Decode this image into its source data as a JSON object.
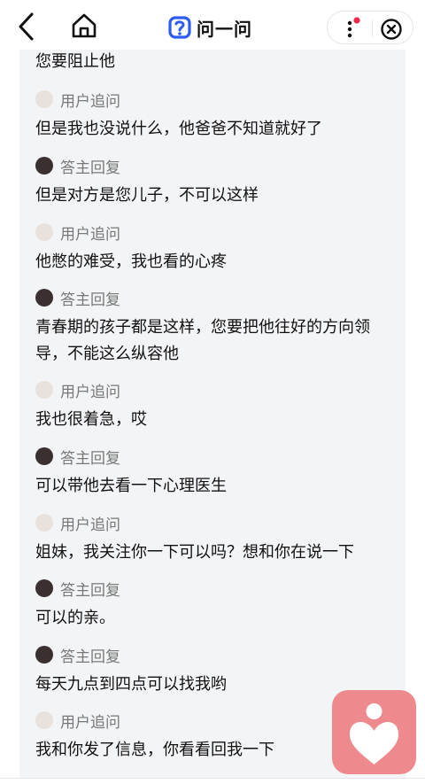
{
  "header": {
    "logo_text": "问一问",
    "brand_color": "#2f5cf0",
    "notification_dot_color": "#f0284a"
  },
  "thread": {
    "lead_text": "您要阻止他",
    "entries": [
      {
        "role": "用户追问",
        "kind": "user",
        "text": "但是我也没说什么，他爸爸不知道就好了"
      },
      {
        "role": "答主回复",
        "kind": "expert",
        "text": "但是对方是您儿子，不可以这样"
      },
      {
        "role": "用户追问",
        "kind": "user",
        "text": "他憋的难受，我也看的心疼"
      },
      {
        "role": "答主回复",
        "kind": "expert",
        "text": "青春期的孩子都是这样，您要把他往好的方向领导，不能这么纵容他"
      },
      {
        "role": "用户追问",
        "kind": "user",
        "text": "我也很着急，哎"
      },
      {
        "role": "答主回复",
        "kind": "expert",
        "text": "可以带他去看一下心理医生"
      },
      {
        "role": "用户追问",
        "kind": "user",
        "text": "姐妹，我关注你一下可以吗？想和你在说一下"
      },
      {
        "role": "答主回复",
        "kind": "expert",
        "text": "可以的亲。"
      },
      {
        "role": "答主回复",
        "kind": "expert",
        "text": "每天九点到四点可以找我哟"
      },
      {
        "role": "用户追问",
        "kind": "user",
        "text": "我和你发了信息，你看看回我一下"
      }
    ]
  },
  "icons": {
    "back": "chevron-left-icon",
    "home": "home-icon",
    "more": "more-vertical-icon",
    "close": "close-circle-icon",
    "heart": "heart-icon"
  },
  "colors": {
    "panel_bg": "#f3f4f6",
    "role_label": "#777777",
    "heart_button": "#ee8a8e"
  }
}
